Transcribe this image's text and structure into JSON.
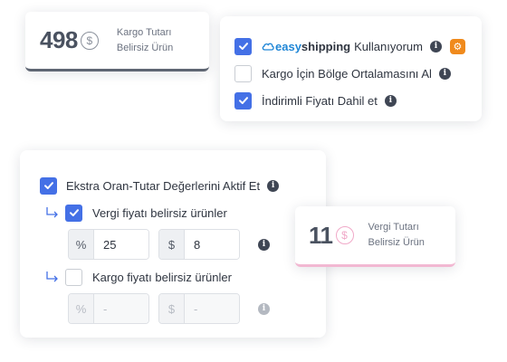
{
  "stat_kargo": {
    "value": "498",
    "coin": "$",
    "label_line1": "Kargo Tutarı",
    "label_line2": "Belirsiz Ürün"
  },
  "stat_vergi": {
    "value": "11",
    "coin": "$",
    "label_line1": "Vergi Tutarı",
    "label_line2": "Belirsiz Ürün"
  },
  "options": {
    "easyshipping": {
      "checked": true,
      "brand_easy": "easy",
      "brand_shipping": "shipping",
      "label": "Kullanıyorum"
    },
    "bolge": {
      "checked": false,
      "label": "Kargo İçin Bölge Ortalamasını Al"
    },
    "indirimli": {
      "checked": true,
      "label": "İndirimli Fiyatı Dahil et"
    }
  },
  "extra": {
    "main_label": "Ekstra Oran-Tutar Değerlerini Aktif Et",
    "main_checked": true,
    "vergi": {
      "checked": true,
      "label": "Vergi fiyatı belirsiz ürünler",
      "percent_prefix": "%",
      "percent_value": "25",
      "amount_prefix": "$",
      "amount_value": "8"
    },
    "kargo": {
      "checked": false,
      "label": "Kargo fiyatı belirsiz ürünler",
      "percent_prefix": "%",
      "percent_value": "-",
      "amount_prefix": "$",
      "amount_value": "-"
    }
  },
  "icons": {
    "info": "i",
    "gear": "⚙"
  },
  "colors": {
    "accent": "#4470e6",
    "brand_blue": "#1f86d6",
    "gear_orange": "#f08a1c",
    "vergi_pink": "#f2b8d2"
  }
}
